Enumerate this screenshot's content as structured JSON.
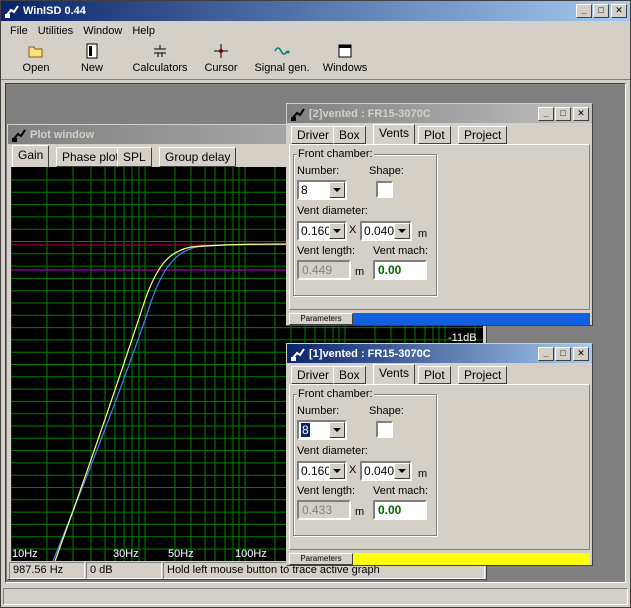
{
  "app": {
    "title": "WinISD 0.44",
    "menu": [
      "File",
      "Utilities",
      "Window",
      "Help"
    ],
    "toolbar": [
      "Open",
      "New",
      "Calculators",
      "Cursor",
      "Signal gen.",
      "Windows"
    ],
    "icons": [
      "open-folder-icon",
      "new-document-icon",
      "calculator-icon",
      "cursor-icon",
      "signal-generator-icon",
      "windows-icon"
    ]
  },
  "plot": {
    "title": "Plot window",
    "tabs": [
      "Gain",
      "Phase plot",
      "SPL",
      "Group delay"
    ],
    "x_labels": [
      "10Hz",
      "30Hz",
      "50Hz",
      "100Hz"
    ],
    "y_label_11db": "-11dB",
    "status": {
      "freq": "987.56 Hz",
      "gain": "0 dB",
      "hint": "Hold left mouse button to trace active graph"
    }
  },
  "vent2": {
    "title": "[2]vented : FR15-3070C",
    "tabs": [
      "Driver",
      "Box",
      "Vents",
      "Plot",
      "Project"
    ],
    "group": "Front chamber:",
    "number_label": "Number:",
    "number": "8",
    "shape_label": "Shape:",
    "diameter_label": "Vent diameter:",
    "diam_a": "0.160",
    "x": "X",
    "diam_b": "0.040",
    "unit_m": "m",
    "length_label": "Vent length:",
    "length": "0.449",
    "mach_label": "Vent mach:",
    "mach": "0.00",
    "params": "Parameters"
  },
  "vent1": {
    "title": "[1]vented : FR15-3070C",
    "tabs": [
      "Driver",
      "Box",
      "Vents",
      "Plot",
      "Project"
    ],
    "group": "Front chamber:",
    "number_label": "Number:",
    "number": "8",
    "shape_label": "Shape:",
    "diameter_label": "Vent diameter:",
    "diam_a": "0.160",
    "x": "X",
    "diam_b": "0.040",
    "unit_m": "m",
    "length_label": "Vent length:",
    "length": "0.433",
    "mach_label": "Vent mach:",
    "mach": "0.00",
    "params": "Parameters"
  },
  "colors": {
    "grid": "#008000",
    "curve1": "#ffff80",
    "curve2": "#4080ff",
    "ref_red": "#c00040",
    "ref_magenta": "#c000c0",
    "bar2": "#1060e0",
    "bar1": "#ffff00"
  }
}
